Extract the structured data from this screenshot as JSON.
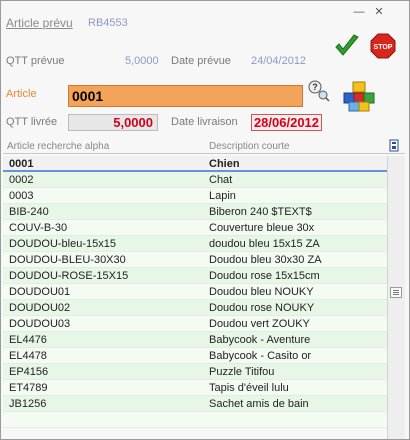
{
  "header": {
    "article_prevu_label": "Article prévu",
    "article_prevu_value": "RB4553",
    "qtt_prevue_label": "QTT prévue",
    "qtt_prevue_value": "5,0000",
    "date_prevue_label": "Date prévue",
    "date_prevue_value": "24/04/2012"
  },
  "window_controls": {
    "minimize": "—",
    "close": "✕"
  },
  "form": {
    "article_label": "Article",
    "article_value": "0001",
    "qtt_livree_label": "QTT livrée",
    "qtt_livree_value": "5,0000",
    "date_livraison_label": "Date livraison",
    "date_livraison_value": "28/06/2012",
    "help_icon_text": "?",
    "stop_text": "STOP"
  },
  "table": {
    "headers": [
      "Article recherche alpha",
      "Description courte"
    ],
    "rows": [
      [
        "0001",
        "Chien"
      ],
      [
        "0002",
        "Chat"
      ],
      [
        "0003",
        "Lapin"
      ],
      [
        "BIB-240",
        "Biberon 240  $TEXT$"
      ],
      [
        "COUV-B-30",
        "Couverture bleue 30x"
      ],
      [
        "DOUDOU-bleu-15x15",
        "doudou bleu 15x15 ZA"
      ],
      [
        "DOUDOU-BLEU-30X30",
        "Doudou bleu 30x30 ZA"
      ],
      [
        "DOUDOU-ROSE-15X15",
        "Doudou rose 15x15cm"
      ],
      [
        "DOUDOU01",
        "Doudou bleu NOUKY"
      ],
      [
        "DOUDOU02",
        "Doudou rose NOUKY"
      ],
      [
        "DOUDOU03",
        "Doudou vert ZOUKY"
      ],
      [
        "EL4476",
        "Babycook - Aventure"
      ],
      [
        "EL4478",
        "Babycook - Casito or"
      ],
      [
        "EP4156",
        "Puzzle Titifou"
      ],
      [
        "ET4789",
        "Tapis d'éveil lulu"
      ],
      [
        "JB1256",
        "Sachet amis de bain"
      ],
      [
        "",
        ""
      ]
    ],
    "selected_index": 0
  },
  "colors": {
    "accent_orange": "#f4a459",
    "value_red": "#d0021b",
    "selected_border": "#6d8fd6"
  }
}
